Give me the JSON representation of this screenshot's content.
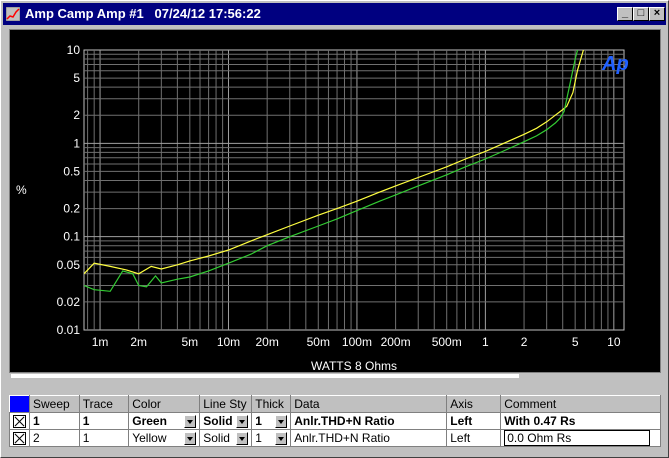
{
  "window": {
    "title": "Amp Camp Amp #1   07/24/12 17:56:22",
    "buttons": {
      "minimize": "_",
      "maximize": "□",
      "close": "×"
    }
  },
  "chart_data": {
    "type": "line",
    "xscale": "log",
    "yscale": "log",
    "xlabel": "WATTS 8 Ohms",
    "ylabel": "%",
    "xlim": [
      0.00075,
      12
    ],
    "ylim": [
      0.01,
      10
    ],
    "grid": true,
    "logo": "Ap",
    "x_ticks": [
      {
        "v": 0.001,
        "label": "1m"
      },
      {
        "v": 0.002,
        "label": "2m"
      },
      {
        "v": 0.005,
        "label": "5m"
      },
      {
        "v": 0.01,
        "label": "10m"
      },
      {
        "v": 0.02,
        "label": "20m"
      },
      {
        "v": 0.05,
        "label": "50m"
      },
      {
        "v": 0.1,
        "label": "100m"
      },
      {
        "v": 0.2,
        "label": "200m"
      },
      {
        "v": 0.5,
        "label": "500m"
      },
      {
        "v": 1,
        "label": "1"
      },
      {
        "v": 2,
        "label": "2"
      },
      {
        "v": 5,
        "label": "5"
      },
      {
        "v": 10,
        "label": "10"
      }
    ],
    "y_ticks": [
      {
        "v": 10,
        "label": "10"
      },
      {
        "v": 5,
        "label": "5"
      },
      {
        "v": 2,
        "label": "2"
      },
      {
        "v": 1,
        "label": "1"
      },
      {
        "v": 0.5,
        "label": "0.5"
      },
      {
        "v": 0.2,
        "label": "0.2"
      },
      {
        "v": 0.1,
        "label": "0.1"
      },
      {
        "v": 0.05,
        "label": "0.05"
      },
      {
        "v": 0.02,
        "label": "0.02"
      },
      {
        "v": 0.01,
        "label": "0.01"
      }
    ],
    "series": [
      {
        "color": "#ffff40",
        "x": [
          0.00075,
          0.0009,
          0.0012,
          0.0016,
          0.002,
          0.0025,
          0.003,
          0.004,
          0.005,
          0.007,
          0.01,
          0.015,
          0.02,
          0.03,
          0.05,
          0.07,
          0.1,
          0.15,
          0.2,
          0.3,
          0.5,
          0.7,
          1,
          1.5,
          2,
          2.5,
          3,
          3.5,
          4,
          4.3,
          4.8,
          5.2,
          5.8,
          6.5
        ],
        "y": [
          0.04,
          0.052,
          0.048,
          0.044,
          0.04,
          0.048,
          0.045,
          0.05,
          0.055,
          0.062,
          0.072,
          0.09,
          0.105,
          0.13,
          0.17,
          0.2,
          0.24,
          0.3,
          0.35,
          0.43,
          0.56,
          0.68,
          0.82,
          1.05,
          1.25,
          1.45,
          1.7,
          2.0,
          2.3,
          2.5,
          3.5,
          6.0,
          10,
          12
        ]
      },
      {
        "color": "#33cc33",
        "x": [
          0.00075,
          0.0009,
          0.0012,
          0.0015,
          0.0018,
          0.002,
          0.0023,
          0.0027,
          0.003,
          0.004,
          0.005,
          0.007,
          0.01,
          0.015,
          0.02,
          0.03,
          0.05,
          0.07,
          0.1,
          0.15,
          0.2,
          0.3,
          0.5,
          0.7,
          1,
          1.5,
          2,
          2.5,
          3,
          3.5,
          3.8,
          4.1,
          4.5,
          5.0,
          5.4
        ],
        "y": [
          0.03,
          0.027,
          0.026,
          0.043,
          0.04,
          0.03,
          0.029,
          0.038,
          0.032,
          0.035,
          0.037,
          0.043,
          0.052,
          0.065,
          0.08,
          0.1,
          0.13,
          0.155,
          0.19,
          0.24,
          0.28,
          0.35,
          0.46,
          0.56,
          0.68,
          0.87,
          1.04,
          1.2,
          1.4,
          1.65,
          1.85,
          2.2,
          4.0,
          8.0,
          12
        ]
      }
    ]
  },
  "legend": {
    "headers": [
      "Sweep",
      "Trace",
      "Color",
      "Line Sty",
      "Thick",
      "Data",
      "Axis",
      "Comment"
    ],
    "rows": [
      {
        "sweep": "1",
        "trace": "1",
        "color": "Green",
        "style": "Solid",
        "thick": "1",
        "data": "Anlr.THD+N Ratio",
        "axis": "Left",
        "comment": "With 0.47 Rs"
      },
      {
        "sweep": "2",
        "trace": "1",
        "color": "Yellow",
        "style": "Solid",
        "thick": "1",
        "data": "Anlr.THD+N Ratio",
        "axis": "Left",
        "comment": "0.0 Ohm Rs"
      }
    ]
  }
}
